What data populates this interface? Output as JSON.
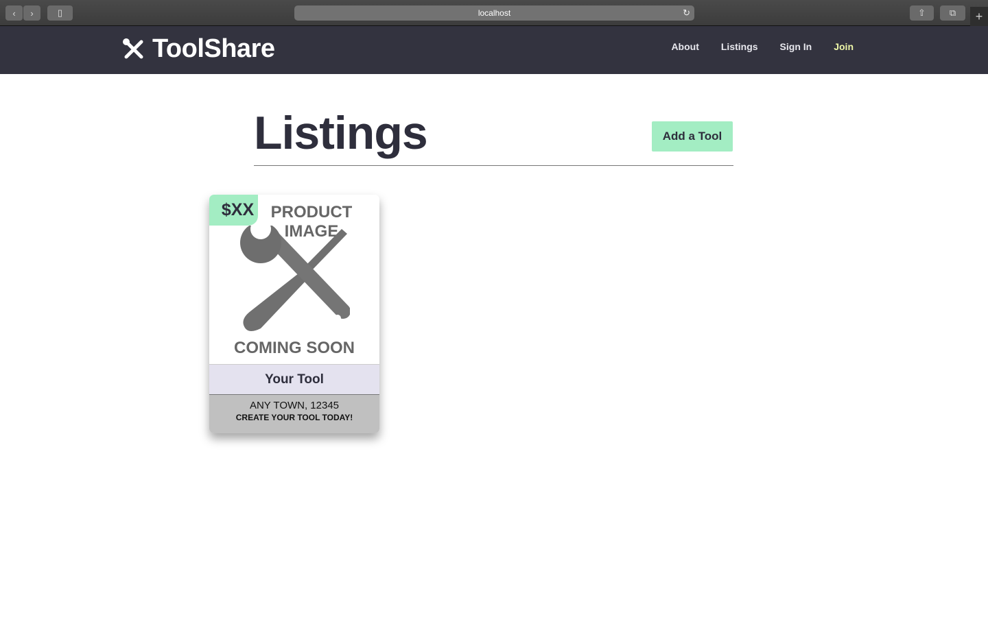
{
  "browser": {
    "url": "localhost"
  },
  "nav": {
    "brand": "ToolShare",
    "links": [
      "About",
      "Listings",
      "Sign In",
      "Join"
    ]
  },
  "page": {
    "title": "Listings",
    "add_button": "Add a Tool"
  },
  "listings": [
    {
      "price": "$XX",
      "image_text_top": "PRODUCT IMAGE",
      "image_text_bottom": "COMING SOON",
      "name": "Your Tool",
      "location": "ANY TOWN, 12345",
      "cta": "CREATE YOUR TOOL TODAY!"
    }
  ],
  "colors": {
    "nav_bg": "#33333f",
    "accent": "#a3edc3",
    "join": "#eef7a8"
  }
}
